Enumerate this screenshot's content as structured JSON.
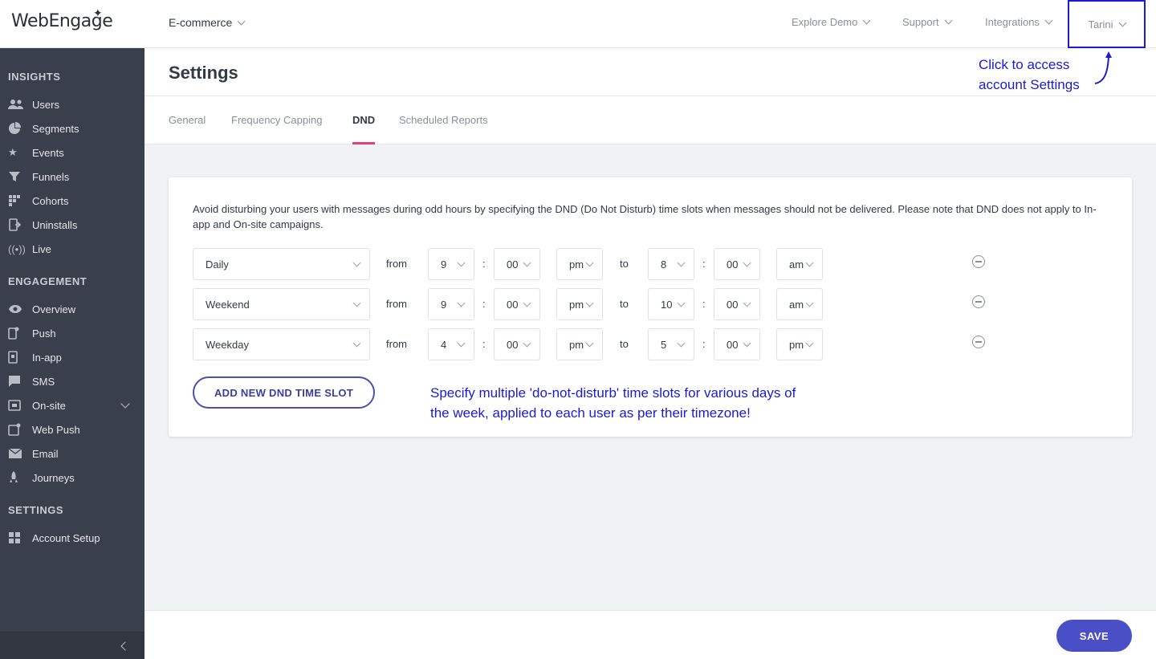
{
  "header": {
    "logo": "WebEngage",
    "project": "E-commerce",
    "nav": [
      "Explore Demo",
      "Support",
      "Integrations"
    ],
    "user": "Tarini"
  },
  "sidebar": {
    "sections": [
      {
        "title": "INSIGHTS",
        "items": [
          {
            "label": "Users",
            "icon": "users-icon"
          },
          {
            "label": "Segments",
            "icon": "segments-icon"
          },
          {
            "label": "Events",
            "icon": "events-icon"
          },
          {
            "label": "Funnels",
            "icon": "funnel-icon"
          },
          {
            "label": "Cohorts",
            "icon": "cohorts-icon"
          },
          {
            "label": "Uninstalls",
            "icon": "uninstall-icon"
          },
          {
            "label": "Live",
            "icon": "live-icon"
          }
        ]
      },
      {
        "title": "ENGAGEMENT",
        "items": [
          {
            "label": "Overview",
            "icon": "eye-icon"
          },
          {
            "label": "Push",
            "icon": "push-icon"
          },
          {
            "label": "In-app",
            "icon": "in-app-icon"
          },
          {
            "label": "SMS",
            "icon": "sms-icon"
          },
          {
            "label": "On-site",
            "icon": "on-site-icon"
          },
          {
            "label": "Web Push",
            "icon": "web-push-icon"
          },
          {
            "label": "Email",
            "icon": "email-icon"
          },
          {
            "label": "Journeys",
            "icon": "journeys-icon"
          }
        ]
      },
      {
        "title": "SETTINGS",
        "items": [
          {
            "label": "Account Setup",
            "icon": "account-setup-icon"
          }
        ]
      }
    ]
  },
  "page": {
    "title": "Settings",
    "tabs": [
      "General",
      "Frequency Capping",
      "DND",
      "Scheduled Reports"
    ],
    "active_tab": "DND"
  },
  "annotations": {
    "settings_note_line1": "Click to access",
    "settings_note_line2": "account Settings",
    "slots_note_line1": "Specify multiple 'do-not-disturb' time slots for various days of",
    "slots_note_line2": "the week, applied to each user as per their timezone!"
  },
  "dnd": {
    "description": "Avoid disturbing your users with messages during odd hours by specifying the DND (Do Not Disturb) time slots when messages should not be delivered. Please note that DND does not apply to In-app and On-site campaigns.",
    "from_label": "from",
    "to_label": "to",
    "colon": ":",
    "slots": [
      {
        "day": "Daily",
        "from_hour": "9",
        "from_min": "00",
        "from_ampm": "pm",
        "to_hour": "8",
        "to_min": "00",
        "to_ampm": "am"
      },
      {
        "day": "Weekend",
        "from_hour": "9",
        "from_min": "00",
        "from_ampm": "pm",
        "to_hour": "10",
        "to_min": "00",
        "to_ampm": "am"
      },
      {
        "day": "Weekday",
        "from_hour": "4",
        "from_min": "00",
        "from_ampm": "pm",
        "to_hour": "5",
        "to_min": "00",
        "to_ampm": "pm"
      }
    ],
    "add_button": "ADD NEW DND TIME SLOT"
  },
  "footer": {
    "save_label": "SAVE"
  },
  "colors": {
    "sidebar_bg": "#3a3f4c",
    "accent": "#4a4fc7",
    "active_tab_underline": "#e43f7a",
    "annotation_blue": "#1b1bd1"
  }
}
